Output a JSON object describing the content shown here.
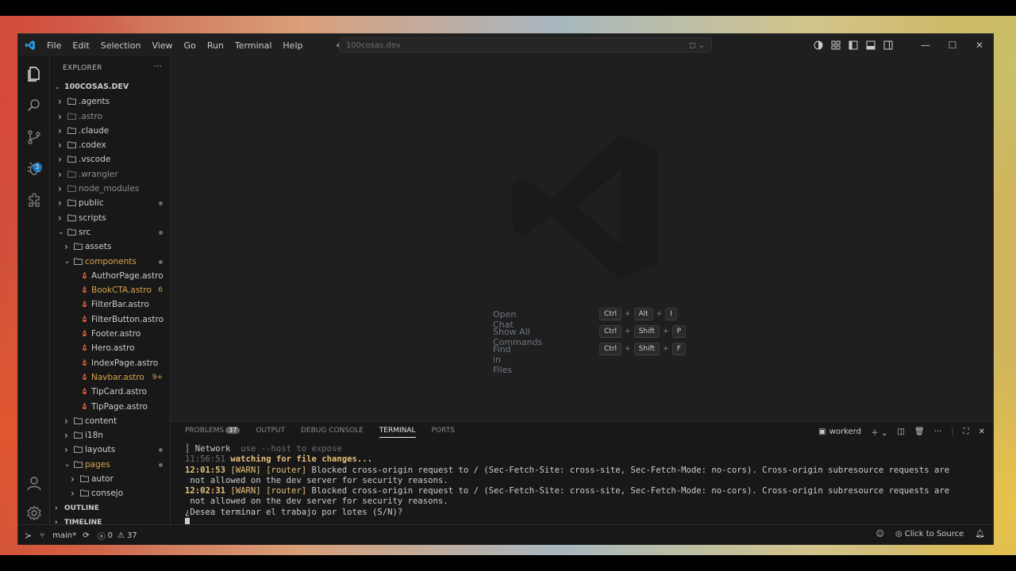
{
  "menu": [
    "File",
    "Edit",
    "Selection",
    "View",
    "Go",
    "Run",
    "Terminal",
    "Help"
  ],
  "search": {
    "text": "100cosas.dev"
  },
  "explorer": {
    "header": "EXPLORER",
    "more": "···",
    "root": "100COSAS.DEV",
    "items": [
      {
        "name": ".agents",
        "depth": 0,
        "type": "folder",
        "open": false,
        "dim": false,
        "color": "#cccccc"
      },
      {
        "name": ".astro",
        "depth": 0,
        "type": "folder",
        "open": false,
        "dim": true,
        "color": "#8c8c8c"
      },
      {
        "name": ".claude",
        "depth": 0,
        "type": "folder",
        "open": false,
        "dim": false,
        "color": "#cccccc"
      },
      {
        "name": ".codex",
        "depth": 0,
        "type": "folder",
        "open": false,
        "dim": false,
        "color": "#cccccc"
      },
      {
        "name": ".vscode",
        "depth": 0,
        "type": "folder",
        "open": false,
        "dim": false,
        "color": "#cccccc"
      },
      {
        "name": ".wrangler",
        "depth": 0,
        "type": "folder",
        "open": false,
        "dim": true,
        "color": "#8c8c8c"
      },
      {
        "name": "node_modules",
        "depth": 0,
        "type": "folder",
        "open": false,
        "dim": true,
        "color": "#8c8c8c"
      },
      {
        "name": "public",
        "depth": 0,
        "type": "folder",
        "open": false,
        "dim": false,
        "color": "#cccccc",
        "dot": true
      },
      {
        "name": "scripts",
        "depth": 0,
        "type": "folder",
        "open": false,
        "dim": false,
        "color": "#cccccc"
      },
      {
        "name": "src",
        "depth": 0,
        "type": "folder",
        "open": true,
        "dim": false,
        "color": "#cccccc",
        "dot": true
      },
      {
        "name": "assets",
        "depth": 1,
        "type": "folder",
        "open": false,
        "dim": false,
        "color": "#cccccc"
      },
      {
        "name": "components",
        "depth": 1,
        "type": "folder",
        "open": true,
        "dim": false,
        "color": "#d7a34b",
        "dot": true
      },
      {
        "name": "AuthorPage.astro",
        "depth": 2,
        "type": "file",
        "color": "#cccccc"
      },
      {
        "name": "BookCTA.astro",
        "depth": 2,
        "type": "file",
        "color": "#d7a34b",
        "count": "6"
      },
      {
        "name": "FilterBar.astro",
        "depth": 2,
        "type": "file",
        "color": "#cccccc"
      },
      {
        "name": "FilterButton.astro",
        "depth": 2,
        "type": "file",
        "color": "#cccccc"
      },
      {
        "name": "Footer.astro",
        "depth": 2,
        "type": "file",
        "color": "#cccccc"
      },
      {
        "name": "Hero.astro",
        "depth": 2,
        "type": "file",
        "color": "#cccccc"
      },
      {
        "name": "IndexPage.astro",
        "depth": 2,
        "type": "file",
        "color": "#cccccc"
      },
      {
        "name": "Navbar.astro",
        "depth": 2,
        "type": "file",
        "color": "#d7a34b",
        "count": "9+"
      },
      {
        "name": "TipCard.astro",
        "depth": 2,
        "type": "file",
        "color": "#cccccc"
      },
      {
        "name": "TipPage.astro",
        "depth": 2,
        "type": "file",
        "color": "#cccccc"
      },
      {
        "name": "content",
        "depth": 1,
        "type": "folder",
        "open": false,
        "dim": false,
        "color": "#cccccc"
      },
      {
        "name": "i18n",
        "depth": 1,
        "type": "folder",
        "open": false,
        "dim": false,
        "color": "#cccccc"
      },
      {
        "name": "layouts",
        "depth": 1,
        "type": "folder",
        "open": false,
        "dim": false,
        "color": "#cccccc",
        "dot": true
      },
      {
        "name": "pages",
        "depth": 1,
        "type": "folder",
        "open": true,
        "dim": false,
        "color": "#d7a34b",
        "dot": true
      },
      {
        "name": "autor",
        "depth": 2,
        "type": "folder",
        "open": false,
        "dim": false,
        "color": "#cccccc"
      },
      {
        "name": "consejo",
        "depth": 2,
        "type": "folder",
        "open": false,
        "dim": false,
        "color": "#cccccc"
      }
    ],
    "outline": "OUTLINE",
    "timeline": "TIMELINE"
  },
  "source_control_badge": "2",
  "shortcuts": [
    {
      "label": "Open Chat",
      "keys": [
        "Ctrl",
        "Alt",
        "I"
      ]
    },
    {
      "label": "Show All Commands",
      "keys": [
        "Ctrl",
        "Shift",
        "P"
      ]
    },
    {
      "label": "Find in Files",
      "keys": [
        "Ctrl",
        "Shift",
        "F"
      ]
    }
  ],
  "panel": {
    "tabs": [
      {
        "label": "PROBLEMS",
        "count": "37",
        "active": false
      },
      {
        "label": "OUTPUT",
        "active": false
      },
      {
        "label": "DEBUG CONSOLE",
        "active": false
      },
      {
        "label": "TERMINAL",
        "active": true
      },
      {
        "label": "PORTS",
        "active": false
      }
    ],
    "terminal_name": "workerd"
  },
  "terminal": {
    "line1_bar": "┃",
    "line1_label": "Network",
    "line1_rest": "use --host to expose",
    "line2_time": "11:56:51",
    "line2_msg": "watching for file changes...",
    "warn1_time": "12:01:53",
    "warn2_time": "12:02:31",
    "warn_tag": "[WARN]",
    "warn_router": "[router]",
    "warn_msg": "Blocked cross-origin request to / (Sec-Fetch-Site: cross-site, Sec-Fetch-Mode: no-cors). Cross-origin subresource requests are",
    "warn_cont": " not allowed on the dev server for security reasons.",
    "prompt": "¿Desea terminar el trabajo por lotes (S/N)?"
  },
  "status": {
    "branch": "main*",
    "errors": "0",
    "warnings": "37",
    "click_to_source": "Click to Source"
  }
}
